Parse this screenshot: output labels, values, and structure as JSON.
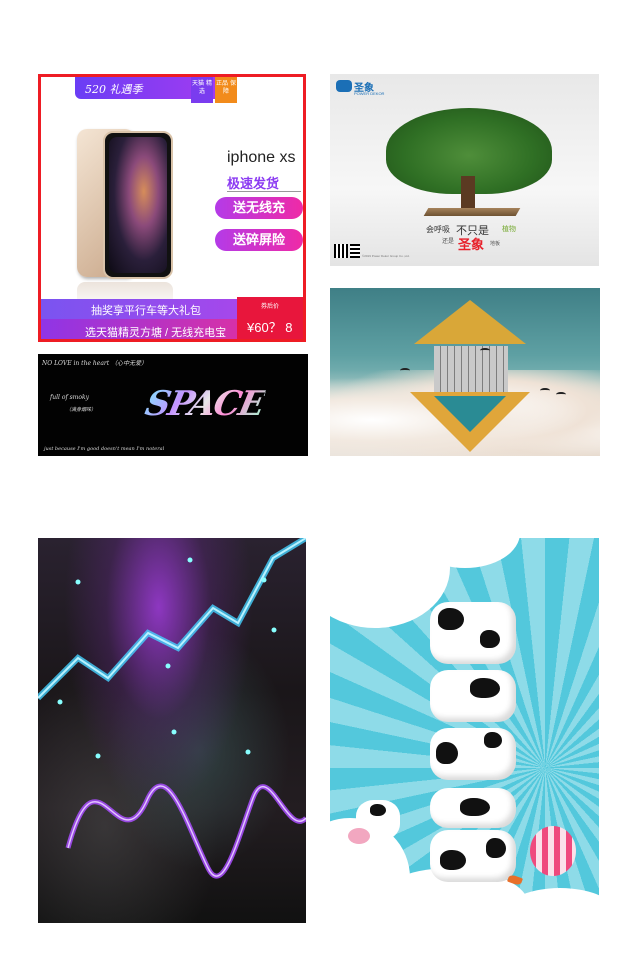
{
  "iphone_ad": {
    "banner": "520 礼遇季",
    "tag_left": "天猫 精选",
    "tag_right": "正品 保障",
    "model": "iphone xs",
    "headline": "极速发货",
    "pill_1": "送无线充",
    "pill_2": "送碎屏险",
    "promo_1": "抽奖享平行车等大礼包",
    "promo_2": "选天猫精灵方塘 / 无线充电宝",
    "price_label": "券后价",
    "price": "¥60？ 8"
  },
  "tree_ad": {
    "brand": "圣象",
    "brand_sub": "POWER DEKOR",
    "line1_a": "会呼吸",
    "line1_b": "不只是",
    "line1_c": "植物",
    "line2_a": "还是",
    "line2_b": "圣象",
    "line2_c": "地板",
    "footnote": "©2019 Power Dekor Group Co.,Ltd."
  },
  "space_art": {
    "line_top": "NO LOVE in the heart （心中无爱）",
    "line_mid": "full of smoky",
    "line_mid_cn": "（满身烟味）",
    "line_bottom": "just because I'm good doesn't mean I'm noteral",
    "title": "SPACE"
  },
  "building_art": {},
  "abstract_art": {},
  "milk_art": {}
}
